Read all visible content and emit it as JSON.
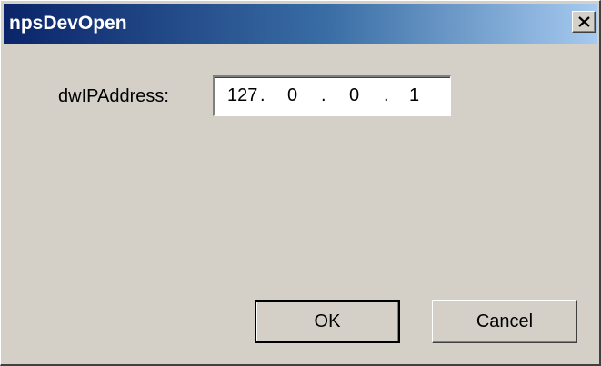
{
  "window": {
    "title": "npsDevOpen",
    "close_icon": "close-icon"
  },
  "form": {
    "ip_label": "dwIPAddress:",
    "ip_octets": [
      "127",
      "0",
      "0",
      "1"
    ],
    "ip_separator": "."
  },
  "buttons": {
    "ok_label": "OK",
    "cancel_label": "Cancel"
  },
  "colors": {
    "titlebar_start": "#0a246a",
    "titlebar_end": "#a6caf0",
    "face": "#d4d0c8"
  }
}
